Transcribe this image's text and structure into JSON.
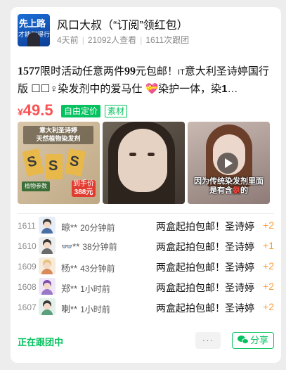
{
  "header": {
    "logo_text_1": "先上路",
    "logo_text_2": "才能到得行者",
    "shop_name": "风口大叔（“订阅”领红包）",
    "posted": "4天前",
    "views": "21092人查看",
    "followers": "1611次跟团"
  },
  "product": {
    "title_num": "1577",
    "title_part1": "限时活动任意两件",
    "title_num2": "99",
    "title_part2": "元包邮！",
    "title_small": "IT",
    "title_part3": "意大利圣诗婷国行版 ",
    "title_icons": "☐☐♀",
    "title_part4": "染发剂中的爱马仕 💝染护一体，染",
    "title_bold": "1",
    "title_ellipsis": "…",
    "currency": "¥",
    "price": "49.5",
    "tag_free": "自由定价",
    "tag_material": "素材"
  },
  "images": {
    "img1_header_1": "意大利圣诗婷",
    "img1_header_2": "天然植物染发剂",
    "img1_price_1": "到手价",
    "img1_price_2": "388元",
    "img1_ingredient": "植物参数",
    "img3_caption_1": "因为传统染发剂里面",
    "img3_caption_2a": "是有含",
    "img3_caption_2b": "氨",
    "img3_caption_2c": "的"
  },
  "orders": [
    {
      "no": "1611",
      "user": "晾**",
      "time": "20分钟前",
      "desc": "两盒起拍包邮！圣诗婷",
      "qty": "+2"
    },
    {
      "no": "1610",
      "user": "👓**",
      "time": "38分钟前",
      "desc": "两盒起拍包邮！圣诗婷",
      "qty": "+1"
    },
    {
      "no": "1609",
      "user": "杨**",
      "time": "43分钟前",
      "desc": "两盒起拍包邮！圣诗婷",
      "qty": "+2"
    },
    {
      "no": "1608",
      "user": "郑**",
      "time": "1小时前",
      "desc": "两盒起拍包邮！圣诗婷",
      "qty": "+2"
    },
    {
      "no": "1607",
      "user": "喇**",
      "time": "1小时前",
      "desc": "两盒起拍包邮！圣诗婷",
      "qty": "+2"
    }
  ],
  "footer": {
    "status": "正在跟团中",
    "more": "···",
    "share": "分享"
  },
  "colors": {
    "accent_green": "#07c160",
    "price_red": "#fa5151",
    "qty_orange": "#fa9d3b"
  }
}
